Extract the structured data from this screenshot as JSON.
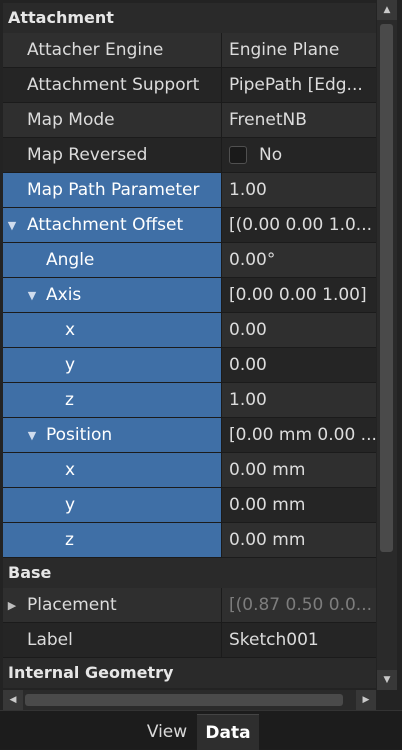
{
  "groups": {
    "attachment": "Attachment",
    "base": "Base",
    "internal": "Internal Geometry"
  },
  "rows": {
    "attacher_engine": {
      "label": "Attacher Engine",
      "value": "Engine Plane"
    },
    "attachment_support": {
      "label": "Attachment Support",
      "value": "PipePath [Edg..."
    },
    "map_mode": {
      "label": "Map Mode",
      "value": "FrenetNB"
    },
    "map_reversed": {
      "label": "Map Reversed",
      "value": "No"
    },
    "map_path_parameter": {
      "label": "Map Path Parameter",
      "value": "1.00"
    },
    "attachment_offset": {
      "label": "Attachment Offset",
      "value": "[(0.00 0.00 1.0..."
    },
    "angle": {
      "label": "Angle",
      "value": "0.00°"
    },
    "axis": {
      "label": "Axis",
      "value": "[0.00 0.00 1.00]"
    },
    "axis_x": {
      "label": "x",
      "value": "0.00"
    },
    "axis_y": {
      "label": "y",
      "value": "0.00"
    },
    "axis_z": {
      "label": "z",
      "value": "1.00"
    },
    "position": {
      "label": "Position",
      "value": "[0.00 mm 0.00 ..."
    },
    "pos_x": {
      "label": "x",
      "value": "0.00 mm"
    },
    "pos_y": {
      "label": "y",
      "value": "0.00 mm"
    },
    "pos_z": {
      "label": "z",
      "value": "0.00 mm"
    },
    "placement": {
      "label": "Placement",
      "value": "[(0.87 0.50 0.0..."
    },
    "label": {
      "label": "Label",
      "value": "Sketch001"
    }
  },
  "tabs": {
    "view": "View",
    "data": "Data",
    "active": "Data"
  },
  "icons": {
    "expanded": "triangle-down-icon",
    "collapsed": "triangle-right-icon",
    "scroll_up": "arrow-up-icon",
    "scroll_down": "arrow-down-icon",
    "scroll_left": "arrow-left-icon",
    "scroll_right": "arrow-right-icon"
  },
  "colors": {
    "selection": "#3f6fa6",
    "background": "#232323",
    "row_odd": "#2f2f2f",
    "row_even": "#252525"
  }
}
